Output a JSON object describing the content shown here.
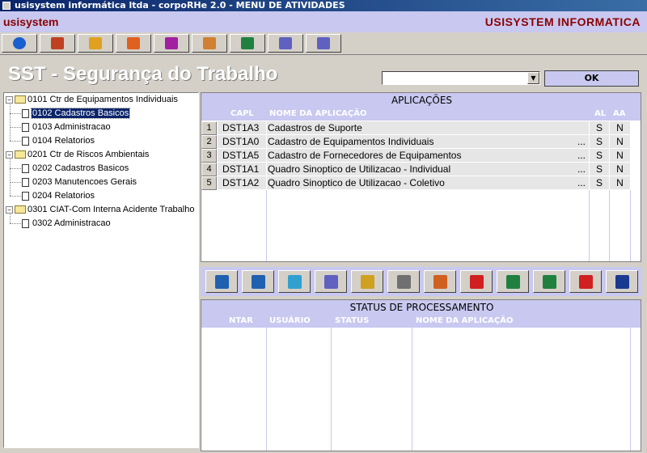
{
  "window": {
    "title": "usisystem informática ltda - corpoRHe 2.0 - MENU DE ATIVIDADES"
  },
  "brand": {
    "left": "usisystem",
    "right": "USISYSTEM INFORMATICA"
  },
  "toolbar": {
    "buttons": [
      {
        "icon": "back-arrow-icon",
        "color": "#1a5fd0"
      },
      {
        "icon": "users-icon",
        "color": "#c04020"
      },
      {
        "icon": "person-icon",
        "color": "#e0a020"
      },
      {
        "icon": "person-remove-icon",
        "color": "#e06020"
      },
      {
        "icon": "checklist-icon",
        "color": "#a020a0"
      },
      {
        "icon": "book-open-icon",
        "color": "#d08030"
      },
      {
        "icon": "book-green-icon",
        "color": "#208040"
      },
      {
        "icon": "report-icon",
        "color": "#6060c0"
      },
      {
        "icon": "report-print-icon",
        "color": "#6060c0"
      }
    ]
  },
  "page": {
    "title": "SST - Segurança do Trabalho"
  },
  "combo": {
    "value": "",
    "arrow": "▼"
  },
  "ok_label": "OK",
  "tree": {
    "nodes": [
      {
        "label": "0101 Ctr de Equipamentos Individuais",
        "type": "folder"
      },
      {
        "label": "0102 Cadastros Basicos",
        "type": "doc",
        "selected": true
      },
      {
        "label": "0103 Administracao",
        "type": "doc"
      },
      {
        "label": "0104 Relatorios",
        "type": "doc"
      },
      {
        "label": "0201 Ctr de Riscos Ambientais",
        "type": "folder"
      },
      {
        "label": "0202 Cadastros Basicos",
        "type": "doc"
      },
      {
        "label": "0203 Manutencoes Gerais",
        "type": "doc"
      },
      {
        "label": "0204 Relatorios",
        "type": "doc"
      },
      {
        "label": "0301 CIAT-Com Interna Acidente Trabalho",
        "type": "folder"
      },
      {
        "label": "0302 Administracao",
        "type": "doc"
      }
    ]
  },
  "applications": {
    "header": "APLICAÇÕES",
    "columns": {
      "capl": "CAPL",
      "nome": "NOME DA APLICAÇÃO",
      "al": "AL",
      "aa": "AA"
    },
    "rows": [
      {
        "num": "1",
        "capl": "DST1A3",
        "nome": "Cadastros de Suporte",
        "ellipsis": "",
        "al": "S",
        "aa": "N"
      },
      {
        "num": "2",
        "capl": "DST1A0",
        "nome": "Cadastro de Equipamentos Individuais",
        "ellipsis": "...",
        "al": "S",
        "aa": "N"
      },
      {
        "num": "3",
        "capl": "DST1A5",
        "nome": "Cadastro de Fornecedores de Equipamentos",
        "ellipsis": "...",
        "al": "S",
        "aa": "N"
      },
      {
        "num": "4",
        "capl": "DST1A1",
        "nome": "Quadro Sinoptico de Utilizacao - Individual",
        "ellipsis": "...",
        "al": "S",
        "aa": "N"
      },
      {
        "num": "5",
        "capl": "DST1A2",
        "nome": "Quadro Sinoptico de Utilizacao - Coletivo",
        "ellipsis": "...",
        "al": "S",
        "aa": "N"
      }
    ]
  },
  "actions": {
    "buttons": [
      {
        "icon": "tree-view-icon",
        "color": "#2060b0"
      },
      {
        "icon": "tree-add-icon",
        "color": "#2060b0"
      },
      {
        "icon": "refresh-icon",
        "color": "#30a0d0"
      },
      {
        "icon": "report-icon",
        "color": "#6060c0"
      },
      {
        "icon": "settings-report-icon",
        "color": "#d0a020"
      },
      {
        "icon": "printer-icon",
        "color": "#707070"
      },
      {
        "icon": "upload-icon",
        "color": "#d06020"
      },
      {
        "icon": "import-red-icon",
        "color": "#d02020"
      },
      {
        "icon": "doc-next-icon",
        "color": "#208040"
      },
      {
        "icon": "doc-export-icon",
        "color": "#208040"
      },
      {
        "icon": "export-red-icon",
        "color": "#d02020"
      },
      {
        "icon": "word-icon",
        "color": "#1a3a90"
      }
    ]
  },
  "status": {
    "header": "STATUS DE PROCESSAMENTO",
    "columns": {
      "ntar": "NTAR",
      "usuario": "USUÁRIO",
      "status": "STATUS",
      "nome": "NOME DA APLICAÇÃO"
    }
  }
}
